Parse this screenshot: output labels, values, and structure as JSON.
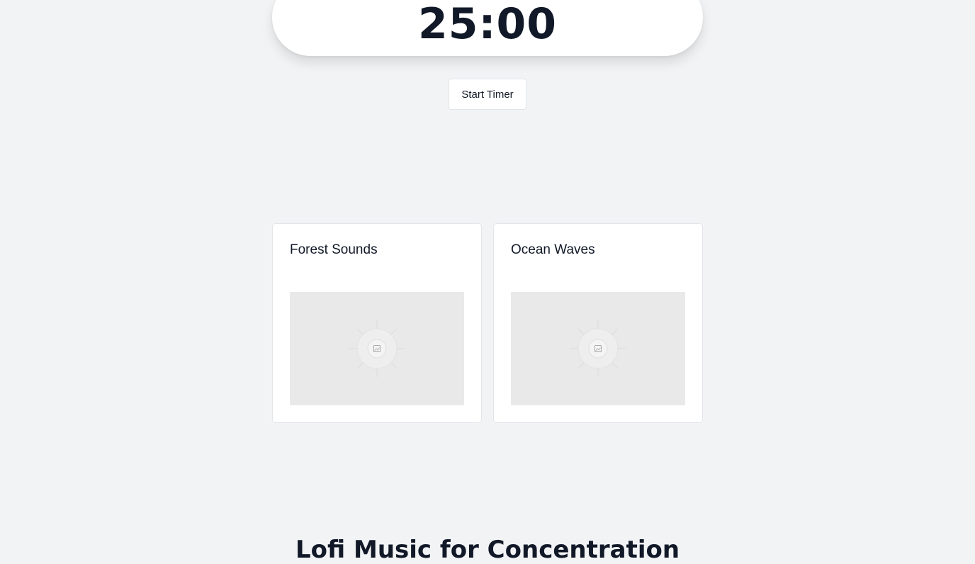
{
  "timer": {
    "display": "25:00",
    "start_label": "Start Timer"
  },
  "sound_cards": [
    {
      "title": "Forest Sounds",
      "image_icon": "image-placeholder-icon"
    },
    {
      "title": "Ocean Waves",
      "image_icon": "image-placeholder-icon"
    }
  ],
  "section": {
    "heading": "Lofi Music for Concentration"
  },
  "colors": {
    "background": "#f2f3f5",
    "surface": "#ffffff",
    "text": "#111827",
    "placeholder": "#e9e9e9"
  }
}
